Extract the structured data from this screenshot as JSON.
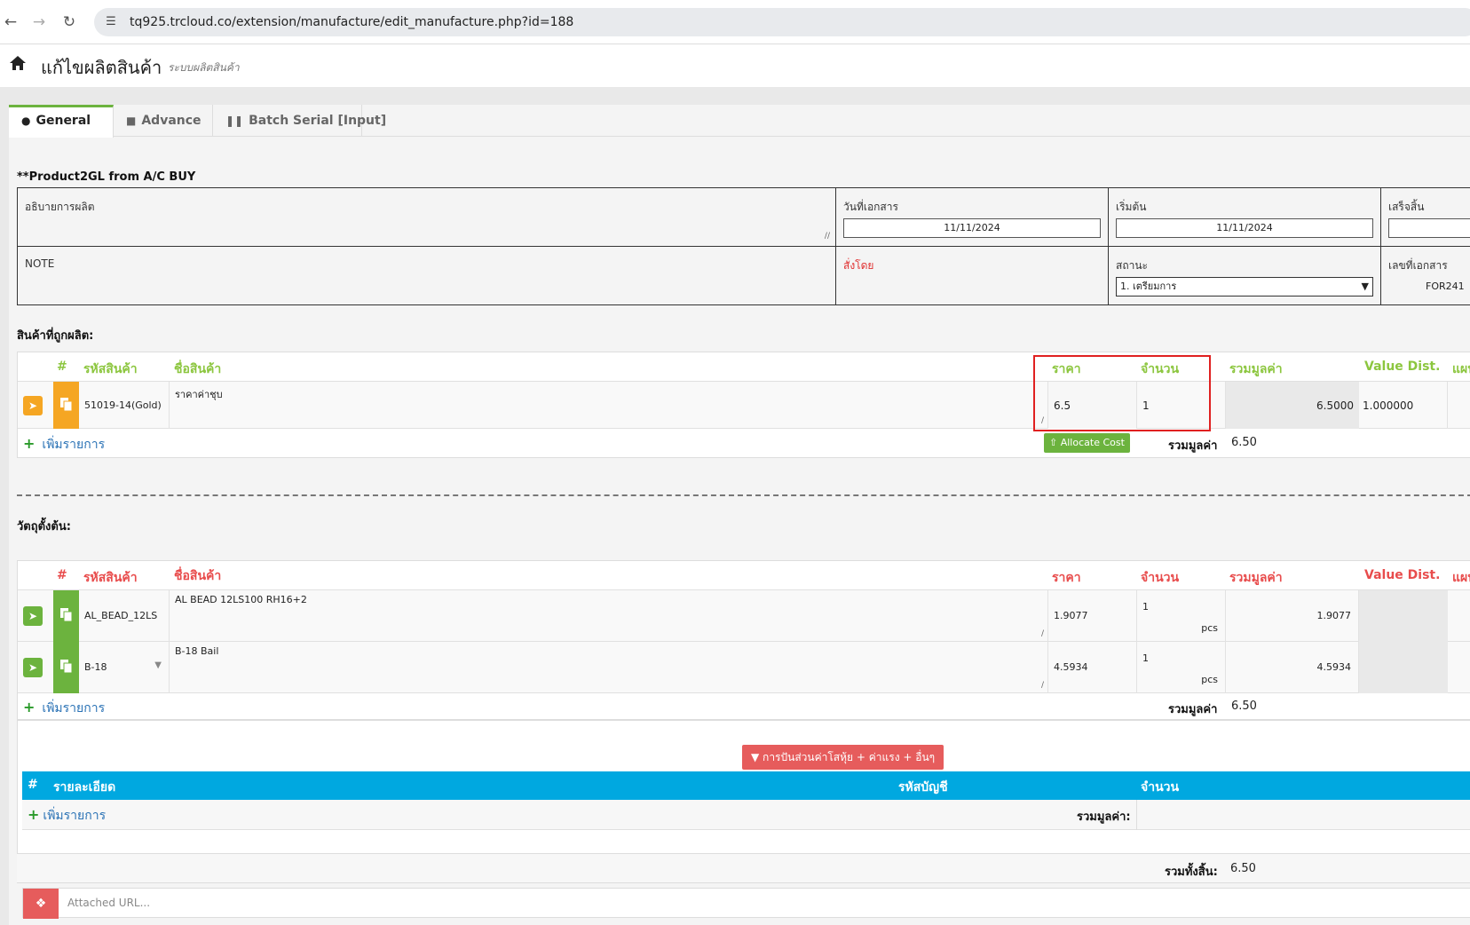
{
  "browser": {
    "url": "tq925.trcloud.co/extension/manufacture/edit_manufacture.php?id=188"
  },
  "header": {
    "title": "แก้ไขผลิตสินค้า",
    "subtitle": "ระบบผลิตสินค้า"
  },
  "tabs": [
    {
      "label": "General",
      "active": true
    },
    {
      "label": "Advance",
      "active": false
    },
    {
      "label": "Batch Serial [Input]",
      "active": false
    }
  ],
  "gl_note": "**Product2GL from A/C BUY",
  "info": {
    "description_label": "อธิบายการผลิต",
    "doc_date_label": "วันที่เอกสาร",
    "doc_date": "11/11/2024",
    "start_label": "เริ่มต้น",
    "start_date": "11/11/2024",
    "finish_label": "เสร็จสิ้น",
    "note_label": "NOTE",
    "ordered_by_label": "สั่งโดย",
    "status_label": "สถานะ",
    "status_value": "1. เตรียมการ",
    "doc_no_label": "เลขที่เอกสาร",
    "doc_no": "FOR241"
  },
  "produced": {
    "section_label": "สินค้าที่ถูกผลิต:",
    "headers": {
      "num": "#",
      "code": "รหัสสินค้า",
      "name": "ชื่อสินค้า",
      "price": "ราคา",
      "qty": "จำนวน",
      "total": "รวมมูลค่า",
      "value_dist": "Value Dist.",
      "extra": "แผน"
    },
    "rows": [
      {
        "code": "51019-14(Gold)",
        "name": "ราคาค่าชุบ",
        "price": "6.5",
        "qty": "1",
        "total": "6.5000",
        "value_dist": "1.000000"
      }
    ],
    "add_label": "เพิ่มรายการ",
    "allocate_label": "Allocate Cost",
    "sum_label": "รวมมูลค่า",
    "sum_value": "6.50"
  },
  "materials": {
    "section_label": "วัตถุตั้งต้น:",
    "headers": {
      "num": "#",
      "code": "รหัสสินค้า",
      "name": "ชื่อสินค้า",
      "price": "ราคา",
      "qty": "จำนวน",
      "total": "รวมมูลค่า",
      "value_dist": "Value Dist.",
      "extra": "แผน"
    },
    "rows": [
      {
        "code": "AL_BEAD_12LS",
        "name": "AL BEAD 12LS100 RH16+2",
        "price": "1.9077",
        "qty": "1",
        "unit": "pcs",
        "total": "1.9077"
      },
      {
        "code": "B-18",
        "name": "B-18  Bail",
        "price": "4.5934",
        "qty": "1",
        "unit": "pcs",
        "total": "4.5934"
      }
    ],
    "add_label": "เพิ่มรายการ",
    "sum_label": "รวมมูลค่า",
    "sum_value": "6.50"
  },
  "overhead": {
    "button_label": "การปันส่วนค่าโสหุ้ย + ค่าแรง + อื่นๆ",
    "headers": {
      "num": "#",
      "detail": "รายละเอียด",
      "account": "รหัสบัญชี",
      "amount": "จำนวน"
    },
    "add_label": "เพิ่มรายการ",
    "sum_label": "รวมมูลค่า:"
  },
  "grand_total": {
    "label": "รวมทั้งสิ้น:",
    "value": "6.50"
  },
  "attach": {
    "placeholder": "Attached URL..."
  },
  "colors": {
    "green": "#8cc63f",
    "red": "#e84c4c",
    "cyan": "#00a8e0",
    "orange": "#f5a623"
  }
}
